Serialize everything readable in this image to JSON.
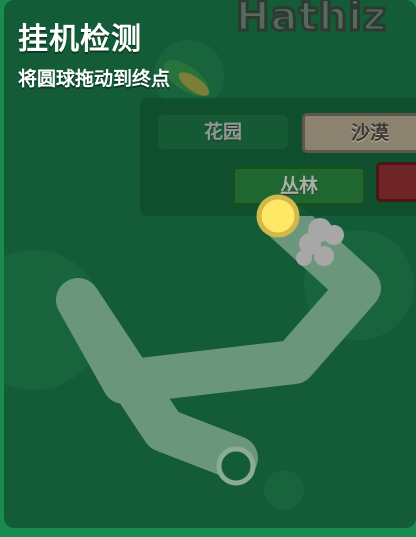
{
  "brand": "Hathiz",
  "title": "挂机检测",
  "subtitle": "将圆球拖动到终点",
  "tabs": {
    "garden": "花园",
    "desert": "沙漠",
    "jungle": "丛林"
  },
  "colors": {
    "page_border": "#1a8a4f",
    "background": "#145c38",
    "path": "#6f9a80",
    "ball_fill": "#ffe866",
    "ball_stroke": "#d1b84a",
    "goal_fill": "#145c38",
    "goal_stroke": "#8cab98",
    "smoke": "#a7a7a7",
    "tab_desert": "#8c8270",
    "tab_red": "#6f2426"
  }
}
